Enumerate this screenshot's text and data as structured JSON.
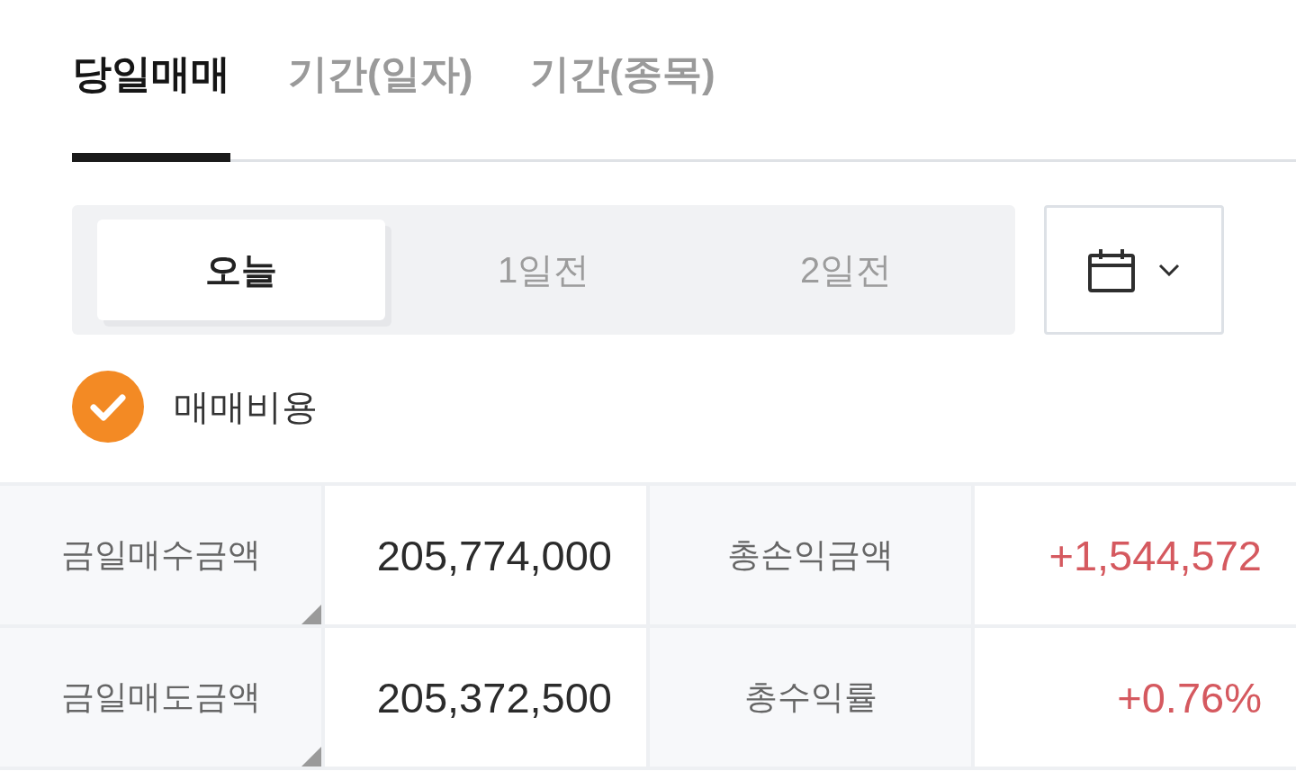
{
  "tabs": [
    {
      "label": "당일매매",
      "selected": true
    },
    {
      "label": "기간(일자)",
      "selected": false
    },
    {
      "label": "기간(종목)",
      "selected": false
    }
  ],
  "day_selector": {
    "options": [
      {
        "label": "오늘",
        "selected": true
      },
      {
        "label": "1일전",
        "selected": false
      },
      {
        "label": "2일전",
        "selected": false
      }
    ]
  },
  "trading_cost": {
    "label": "매매비용",
    "checked": true
  },
  "summary": {
    "rows": [
      {
        "items": [
          {
            "label": "금일매수금액",
            "value": "205,774,000",
            "kind": "plain",
            "expandable": true
          },
          {
            "label": "총손익금액",
            "value": "+1,544,572",
            "kind": "gain",
            "expandable": false
          }
        ]
      },
      {
        "items": [
          {
            "label": "금일매도금액",
            "value": "205,372,500",
            "kind": "plain",
            "expandable": true
          },
          {
            "label": "총수익률",
            "value": "+0.76%",
            "kind": "gain",
            "expandable": false
          }
        ]
      }
    ]
  }
}
